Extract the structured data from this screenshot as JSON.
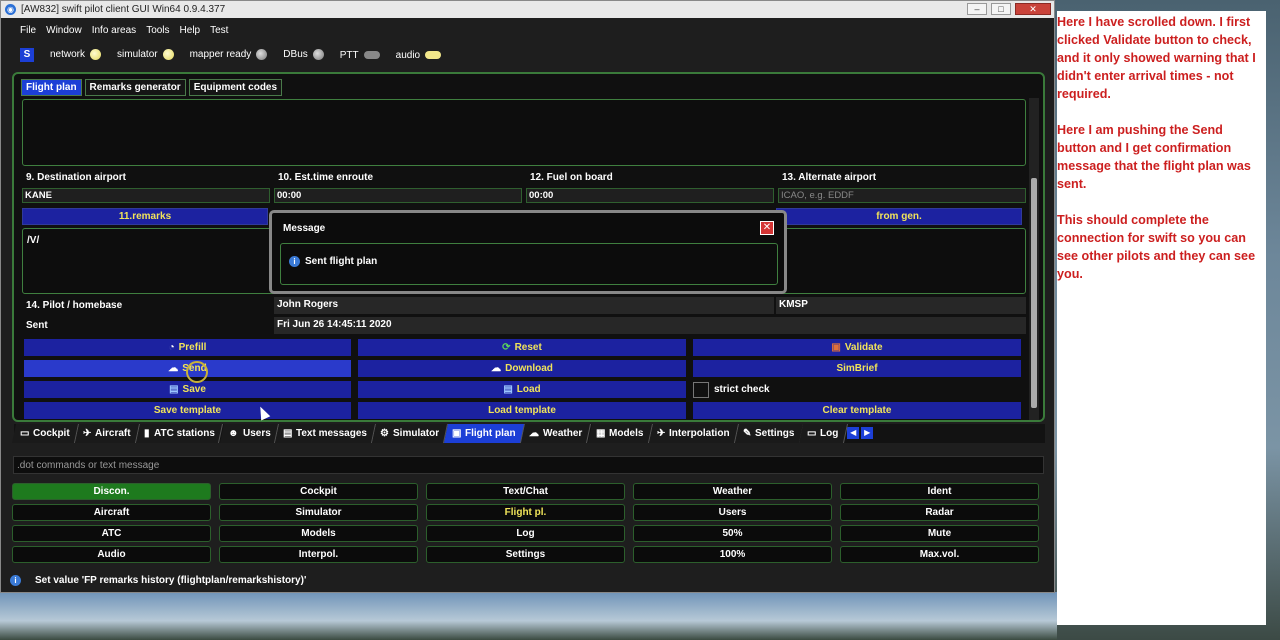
{
  "window": {
    "title": "[AW832] swift pilot client GUI Win64 0.9.4.377"
  },
  "menu": [
    "File",
    "Window",
    "Info areas",
    "Tools",
    "Help",
    "Test"
  ],
  "status_indicators": {
    "badge": "S",
    "items": [
      {
        "label": "network",
        "state": "on"
      },
      {
        "label": "simulator",
        "state": "on"
      },
      {
        "label": "mapper ready",
        "state": "off"
      },
      {
        "label": "DBus",
        "state": "off"
      },
      {
        "label": "PTT",
        "state": "off"
      },
      {
        "label": "audio",
        "state": "on"
      }
    ]
  },
  "subtabs": [
    "Flight plan",
    "Remarks generator",
    "Equipment codes"
  ],
  "fields": {
    "dest_label": "9. Destination airport",
    "dest_value": "KANE",
    "ete_label": "10. Est.time enroute",
    "ete_value": "00:00",
    "fuel_label": "12. Fuel on board",
    "fuel_value": "00:00",
    "alt_label": "13. Alternate airport",
    "alt_placeholder": "ICAO, e.g. EDDF",
    "remarks_bar": "11.remarks",
    "remarks_gen_bar": "from gen.",
    "remarks_value": "/V/",
    "pilot_label": "14. Pilot / homebase",
    "pilot_name": "John Rogers",
    "pilot_home": "KMSP",
    "sent_label": "Sent",
    "sent_value": "Fri Jun 26 14:45:11 2020"
  },
  "message": {
    "title": "Message",
    "text": "Sent flight plan"
  },
  "buttons": {
    "prefill": "Prefill",
    "reset": "Reset",
    "validate": "Validate",
    "send": "Send",
    "download": "Download",
    "simbrief": "SimBrief",
    "save": "Save",
    "load": "Load",
    "strict_check": "strict check",
    "save_template": "Save template",
    "load_template": "Load template",
    "clear_template": "Clear template"
  },
  "tabs": [
    "Cockpit",
    "Aircraft",
    "ATC stations",
    "Users",
    "Text messages",
    "Simulator",
    "Flight plan",
    "Weather",
    "Models",
    "Interpolation",
    "Settings",
    "Log"
  ],
  "command_placeholder": ".dot commands or text message",
  "grid": [
    [
      "Discon.",
      "Cockpit",
      "Text/Chat",
      "Weather",
      "Ident"
    ],
    [
      "Aircraft",
      "Simulator",
      "Flight pl.",
      "Users",
      "Radar"
    ],
    [
      "ATC",
      "Models",
      "Log",
      "50%",
      "Mute"
    ],
    [
      "Audio",
      "Interpol.",
      "Settings",
      "100%",
      "Max.vol."
    ]
  ],
  "statusbar": "Set value 'FP remarks history (flightplan/remarkshistory)'",
  "annotation": [
    "Here I have scrolled down.  I first clicked Validate button to check, and it only showed warning that I didn't enter arrival times - not required.",
    "Here I am pushing the Send button and I get confirmation message that the flight plan was sent.",
    "This should complete the connection for swift so you can see other pilots and they can see you."
  ]
}
